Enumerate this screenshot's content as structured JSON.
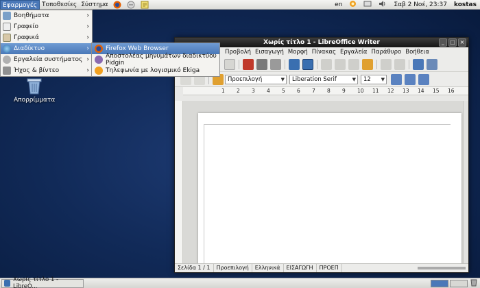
{
  "top_panel": {
    "menus": [
      "Εφαρμογές",
      "Τοποθεσίες",
      "Σύστημα"
    ],
    "language": "en",
    "clock": "Σαβ 2 Νοέ, 23:37",
    "user": "kostas"
  },
  "app_menu": {
    "items": [
      {
        "label": "Βοηθήματα",
        "icon": "accessories-icon"
      },
      {
        "label": "Γραφείο",
        "icon": "office-icon"
      },
      {
        "label": "Γραφικά",
        "icon": "graphics-icon"
      },
      {
        "label": "Διαδίκτυο",
        "icon": "internet-icon"
      },
      {
        "label": "Εργαλεία συστήματος",
        "icon": "system-tools-icon"
      },
      {
        "label": "Ήχος & βίντεο",
        "icon": "sound-video-icon"
      }
    ],
    "selected_index": 3
  },
  "sub_menu": {
    "items": [
      {
        "label": "Firefox Web Browser",
        "icon": "firefox-icon"
      },
      {
        "label": "Αποστολέας μηνυμάτων διαδικτύου Pidgin",
        "icon": "pidgin-icon"
      },
      {
        "label": "Τηλεφωνία με λογισμικό Ekiga",
        "icon": "ekiga-icon"
      }
    ],
    "selected_index": 0
  },
  "desktop": {
    "trash_label": "Απορρίμματα"
  },
  "writer": {
    "title": "Χωρίς τίτλο 1 - LibreOffice Writer",
    "menus": [
      "Προβολή",
      "Εισαγωγή",
      "Μορφή",
      "Πίνακας",
      "Εργαλεία",
      "Παράθυρο",
      "Βοήθεια"
    ],
    "paragraph_style": "Προεπιλογή",
    "font_name": "Liberation Serif",
    "font_size": "12",
    "ruler_numbers": [
      "1",
      "2",
      "3",
      "4",
      "5",
      "6",
      "7",
      "8",
      "9",
      "10",
      "11",
      "12",
      "13",
      "14",
      "15",
      "16"
    ],
    "status": {
      "page": "Σελίδα 1 / 1",
      "style": "Προεπιλογή",
      "language": "Ελληνικά",
      "insert_mode": "ΕΙΣΑΓΩΓΗ",
      "selection_mode": "ΠΡΟΕΠ"
    }
  },
  "taskbar": {
    "task_label": "Χωρίς τίτλο 1 - LibreO..."
  },
  "colors": {
    "accent": "#4a78b8",
    "desktop": "#112a58"
  }
}
